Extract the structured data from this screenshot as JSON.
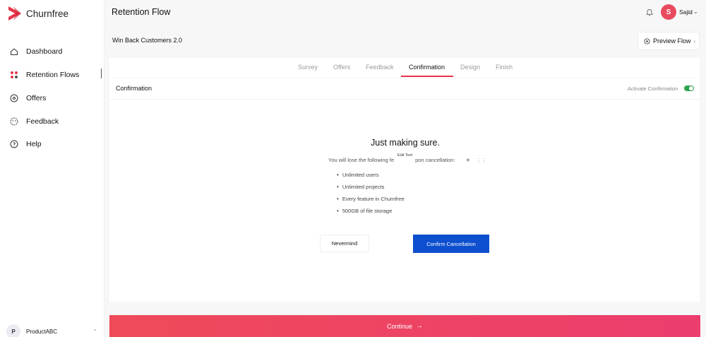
{
  "app": {
    "name": "Churnfree",
    "brand_color": "#e9344a"
  },
  "sidebar": {
    "items": [
      {
        "label": "Dashboard",
        "icon": "home-icon"
      },
      {
        "label": "Retention Flows",
        "icon": "retention-flows-icon",
        "active": true
      },
      {
        "label": "Offers",
        "icon": "offers-tag-icon"
      },
      {
        "label": "Feedback",
        "icon": "feedback-icon"
      },
      {
        "label": "Help",
        "icon": "help-icon"
      }
    ],
    "product": {
      "initial": "P",
      "name": "ProductABC"
    }
  },
  "header": {
    "title": "Retention Flow",
    "user": {
      "initial": "S",
      "name": "Sajid",
      "avatar_color": "#e84a5f"
    }
  },
  "flow": {
    "name": "Win Back Customers 2.0",
    "preview_label": "Preview Flow"
  },
  "tabs": [
    {
      "label": "Survey"
    },
    {
      "label": "Offers"
    },
    {
      "label": "Feedback"
    },
    {
      "label": "Confirmation",
      "active": true
    },
    {
      "label": "Design"
    },
    {
      "label": "Finish"
    }
  ],
  "confirmation": {
    "section_title": "Confirmation",
    "activate_label": "Activate Confirmation",
    "activate_on": true,
    "heading": "Just making sure.",
    "subtext_before": "You will lose the following fe",
    "subtext_after": "pon cancellation:",
    "edit_tooltip": "Edit Text",
    "features": [
      "Unlimited users",
      "Unlimited projects",
      "Every feature in Churnfree",
      "500GB of file storage"
    ],
    "nevermind_label": "Nevermind",
    "confirm_label": "Confirm Cancellation",
    "confirm_color": "#0d4fcf"
  },
  "footer": {
    "continue_label": "Continue"
  }
}
